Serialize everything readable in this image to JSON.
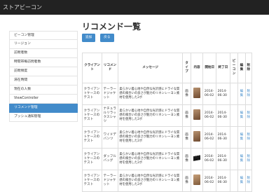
{
  "app": {
    "title": "ストアビーコン"
  },
  "sidebar": {
    "items": [
      {
        "label": "ビーコン管理"
      },
      {
        "label": "リージョン"
      },
      {
        "label": "訪問者数"
      },
      {
        "label": "時間帯毎訪問者数"
      },
      {
        "label": "訪問頻度"
      },
      {
        "label": "滞在時間"
      },
      {
        "label": "現在の人数"
      },
      {
        "label": "ViewController"
      },
      {
        "label": "リコメンド管理"
      },
      {
        "label": "プッシュ通知管理"
      }
    ]
  },
  "main": {
    "title": "リコメンド一覧",
    "buttons": {
      "add": "追加",
      "back": "戻る"
    }
  },
  "table": {
    "headers": {
      "client": "クライアント",
      "recommend": "リコメンド",
      "message": "メッセージ",
      "type": "タイプ",
      "content": "内容",
      "start": "開始日",
      "end": "終了日",
      "beacon": "ビーコン",
      "edit": "編集",
      "delete": "削除"
    },
    "rows": [
      {
        "client": "クライアントケースのテスト",
        "recommend": "テーラードジャケット",
        "message": "柔らかい着心地や自然な光沢感にドライな質感の風合いの良さが魅力のリネンレーヨン素材を使用した2ボ",
        "type": "画像",
        "start": "2014-06-02",
        "end": "2014-06-30",
        "edit": "編集",
        "delete": "削除"
      },
      {
        "client": "クライアントケースのテスト",
        "recommend": "ナチュラルリラックスシャツ",
        "message": "柔らかい着心地や自然な光沢感にドライな質感の風合いの良さが魅力のリネンレーヨン素材を使用した2ボ",
        "type": "画像",
        "start": "2014-06-02",
        "end": "2014-06-30",
        "edit": "編集",
        "delete": "削除"
      },
      {
        "client": "クライアントケースのテスト",
        "recommend": "ワイドデバンツ",
        "message": "柔らかい着心地や自然な光沢感にドライな質感の風合いの良さが魅力のリネンレーヨン素材を使用した2ボ",
        "type": "画像",
        "start": "2014-06-02",
        "end": "2014-06-30",
        "edit": "編集",
        "delete": "削除"
      },
      {
        "client": "クライアントケースのテスト",
        "recommend": "ダッフルバッグ",
        "message": "柔らかい着心地や自然な光沢感にドライな質感の風合いの良さが魅力のリネンレーヨン素材を使用した2ボ",
        "type": "画像",
        "start": "2014-06-02",
        "end": "2014-06-30",
        "edit": "編集",
        "delete": "削除"
      },
      {
        "client": "クライアントケースのテスト",
        "recommend": "テーラードジャケット",
        "message": "柔らかい着心地や自然な光沢感にドライな質感の風合いの良さが魅力のリネンレーヨン素材を使用した2ボ",
        "type": "画像",
        "start": "2014-06-02",
        "end": "2014-06-30",
        "edit": "編集",
        "delete": "削除"
      }
    ]
  },
  "colors": {
    "topbar": "#222222",
    "accent": "#428bca",
    "border": "#dddddd"
  },
  "icons": {
    "thumbnail": "product-photo-icon"
  }
}
